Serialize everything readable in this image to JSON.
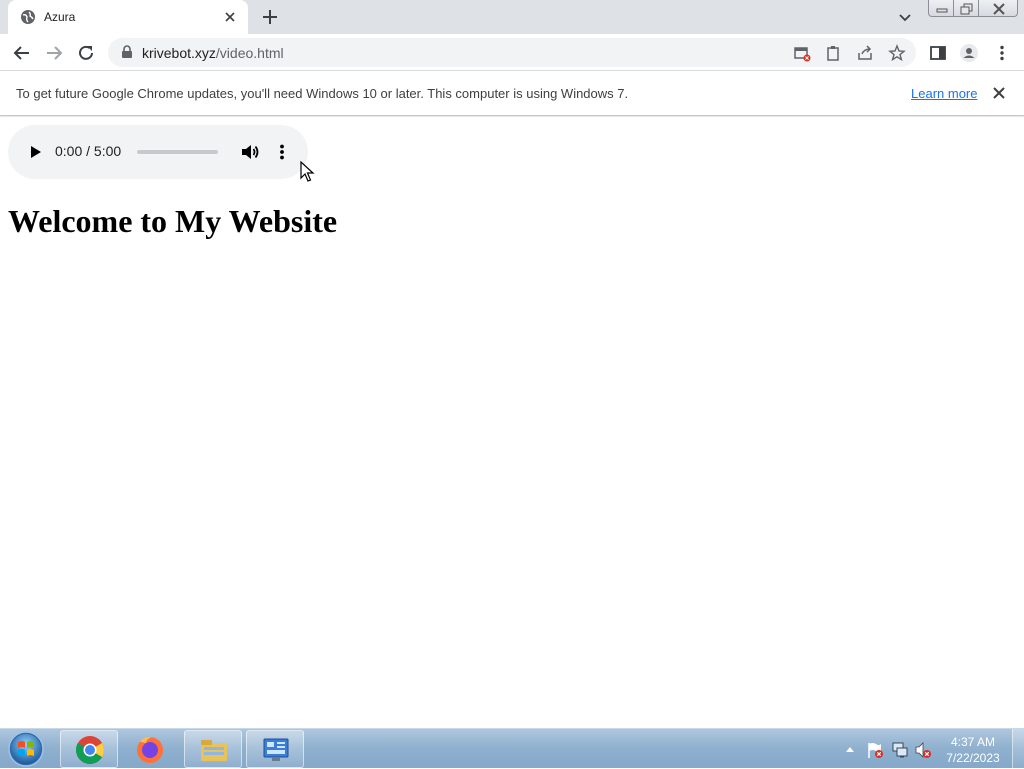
{
  "browser": {
    "tab_title": "Azura",
    "url_host": "krivebot.xyz",
    "url_path": "/video.html"
  },
  "infobar": {
    "message": "To get future Google Chrome updates, you'll need Windows 10 or later. This computer is using Windows 7.",
    "learn_more": "Learn more"
  },
  "page": {
    "audio_player": {
      "time": "0:00 / 5:00",
      "progress": 0
    },
    "heading": "Welcome to My Website"
  },
  "taskbar": {
    "apps": [
      "chrome-icon",
      "firefox-icon",
      "file-explorer-icon",
      "control-panel-icon"
    ],
    "clock_time": "4:37 AM",
    "clock_date": "7/22/2023"
  },
  "colors": {
    "tabstrip_bg": "#dee1e6",
    "omnibox_bg": "#f1f3f4",
    "link": "#1a73e8",
    "taskbar": "#8fb0cf"
  }
}
